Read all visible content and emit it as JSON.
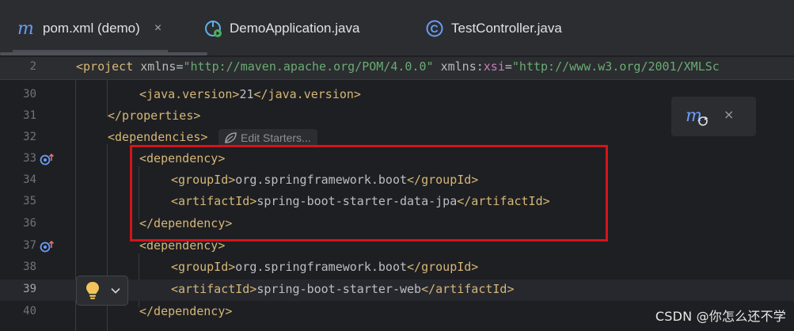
{
  "tabs": [
    {
      "label": "pom.xml (demo)",
      "icon": "maven-m-icon",
      "active": true,
      "close": "×"
    },
    {
      "label": "DemoApplication.java",
      "icon": "spring-boot-run-icon",
      "active": false
    },
    {
      "label": "TestController.java",
      "icon": "java-class-icon",
      "active": false
    }
  ],
  "editor": {
    "lines": [
      {
        "num": "2",
        "parts": [
          {
            "t": "<project ",
            "c": "tag"
          },
          {
            "t": "xmlns",
            "c": "attr"
          },
          {
            "t": "=",
            "c": "txt"
          },
          {
            "t": "\"http://maven.apache.org/POM/4.0.0\"",
            "c": "str"
          },
          {
            "t": " ",
            "c": "txt"
          },
          {
            "t": "xmlns",
            "c": "attr"
          },
          {
            "t": ":",
            "c": "txt"
          },
          {
            "t": "xsi",
            "c": "ns"
          },
          {
            "t": "=",
            "c": "txt"
          },
          {
            "t": "\"http://www.w3.org/2001/XMLSc",
            "c": "str"
          }
        ]
      },
      {
        "num": "30",
        "parts": [
          {
            "t": "<java.version>",
            "c": "tag"
          },
          {
            "t": "21",
            "c": "txt"
          },
          {
            "t": "</java.version>",
            "c": "tag"
          }
        ]
      },
      {
        "num": "31",
        "parts": [
          {
            "t": "</properties>",
            "c": "tag"
          }
        ]
      },
      {
        "num": "32",
        "parts": [
          {
            "t": "<dependencies>",
            "c": "tag"
          }
        ]
      },
      {
        "num": "33",
        "parts": [
          {
            "t": "<dependency>",
            "c": "tag"
          }
        ]
      },
      {
        "num": "34",
        "parts": [
          {
            "t": "<groupId>",
            "c": "tag"
          },
          {
            "t": "org.springframework.boot",
            "c": "txt"
          },
          {
            "t": "</groupId>",
            "c": "tag"
          }
        ]
      },
      {
        "num": "35",
        "parts": [
          {
            "t": "<artifactId>",
            "c": "tag"
          },
          {
            "t": "spring-boot-starter-data-jpa",
            "c": "txt"
          },
          {
            "t": "</artifactId>",
            "c": "tag"
          }
        ]
      },
      {
        "num": "36",
        "parts": [
          {
            "t": "</dependency>",
            "c": "tag"
          }
        ]
      },
      {
        "num": "37",
        "parts": [
          {
            "t": "<dependency>",
            "c": "tag"
          }
        ]
      },
      {
        "num": "38",
        "parts": [
          {
            "t": "<groupId>",
            "c": "tag"
          },
          {
            "t": "org.springframework.boot",
            "c": "txt"
          },
          {
            "t": "</groupId>",
            "c": "tag"
          }
        ]
      },
      {
        "num": "39",
        "parts": [
          {
            "t": "<artifactId>",
            "c": "tag"
          },
          {
            "t": "spring-boot-starter-web",
            "c": "txt"
          },
          {
            "t": "</artifactId>",
            "c": "tag"
          }
        ]
      },
      {
        "num": "40",
        "parts": [
          {
            "t": "</dependency>",
            "c": "tag"
          }
        ]
      }
    ],
    "current_line": "39",
    "inlay_hint": "Edit Starters...",
    "gutter_icons": [
      "dependency-navigate-icon",
      "dependency-navigate-icon"
    ]
  },
  "maven_panel": {
    "icon": "maven-reload-icon",
    "close": "×"
  },
  "intention": {
    "icon": "lightbulb-icon",
    "chevron": "chevron-down-icon"
  },
  "watermark": "CSDN @你怎么还不学",
  "colors": {
    "background": "#1e1f22",
    "tag": "#d5b778",
    "string": "#6aab73",
    "namespace": "#c77dbb",
    "highlight_border": "#d4141b",
    "maven_blue": "#6b9bfa"
  }
}
